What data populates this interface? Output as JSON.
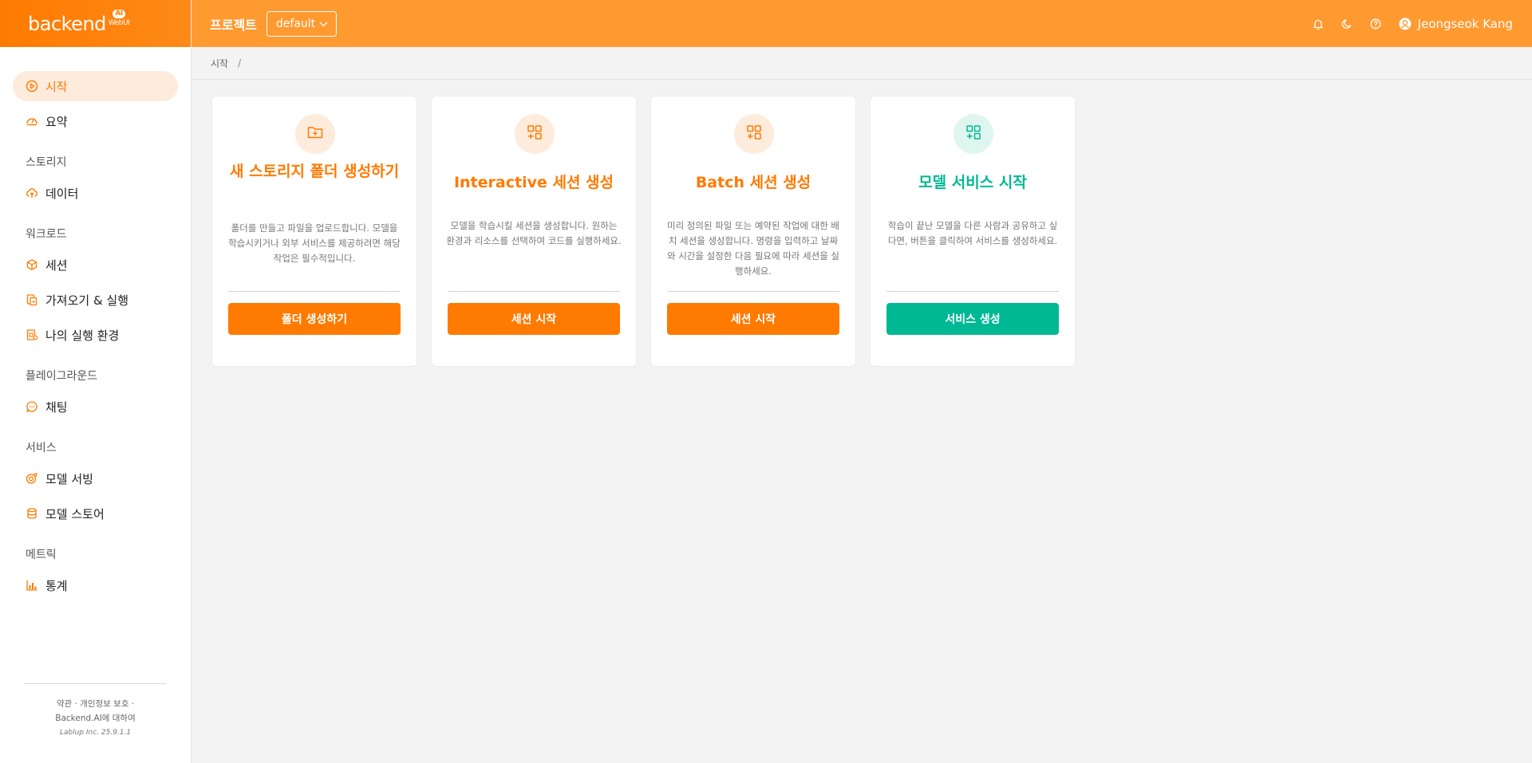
{
  "logo": {
    "text": "backend",
    "ai": "AI",
    "webui": "WebUI"
  },
  "header": {
    "project_label": "프로젝트",
    "project_value": "default",
    "user_name": "Jeongseok Kang"
  },
  "sidebar": {
    "items_top": [
      {
        "label": "시작",
        "icon": "play-circle-icon",
        "active": true
      },
      {
        "label": "요약",
        "icon": "dashboard-icon"
      }
    ],
    "groups": [
      {
        "title": "스토리지",
        "items": [
          {
            "label": "데이터",
            "icon": "cloud-upload-icon"
          }
        ]
      },
      {
        "title": "워크로드",
        "items": [
          {
            "label": "세션",
            "icon": "cube-icon"
          },
          {
            "label": "가져오기 & 실행",
            "icon": "import-icon"
          },
          {
            "label": "나의 실행 환경",
            "icon": "environment-icon"
          }
        ]
      },
      {
        "title": "플레이그라운드",
        "items": [
          {
            "label": "채팅",
            "icon": "chat-icon"
          }
        ]
      },
      {
        "title": "서비스",
        "items": [
          {
            "label": "모델 서빙",
            "icon": "serving-icon"
          },
          {
            "label": "모델 스토어",
            "icon": "database-icon"
          }
        ]
      },
      {
        "title": "메트릭",
        "items": [
          {
            "label": "통계",
            "icon": "bar-chart-icon"
          }
        ]
      }
    ],
    "footer": {
      "line1": "약관 · 개인정보 보호 ·",
      "line2": "Backend.AI에 대하여",
      "version": "Lablup Inc. 25.9.1.1"
    }
  },
  "breadcrumb": {
    "current": "시작",
    "separator": "/"
  },
  "cards": [
    {
      "title": "새 스토리지 폴더 생성하기",
      "description": "폴더를 만들고 파일을 업로드합니다. 모델을 학습시키거나 외부 서비스를 제공하려면 해당 작업은 필수적입니다.",
      "button": "폴더 생성하기",
      "icon": "folder-add-icon",
      "accent": "#ff7a00"
    },
    {
      "title": "Interactive 세션 생성",
      "description": "모델을 학습시킬 세션을 생성합니다. 원하는 환경과 리소스를 선택하여 코드를 실행하세요.",
      "button": "세션 시작",
      "icon": "app-add-icon",
      "accent": "#ff7a00"
    },
    {
      "title": "Batch 세션 생성",
      "description": "미리 정의된 파일 또는 예약된 작업에 대한 배치 세션을 생성합니다. 명령을 입력하고 날짜와 시간을 설정한 다음 필요에 따라 세션을 실행하세요.",
      "button": "세션 시작",
      "icon": "app-add-icon",
      "accent": "#ff7a00"
    },
    {
      "title": "모델 서비스 시작",
      "description": "학습이 끝난 모델을 다른 사람과 공유하고 싶다면, 버튼을 클릭하여 서비스를 생성하세요.",
      "button": "서비스 생성",
      "icon": "app-add-icon",
      "accent": "#00b894"
    }
  ]
}
